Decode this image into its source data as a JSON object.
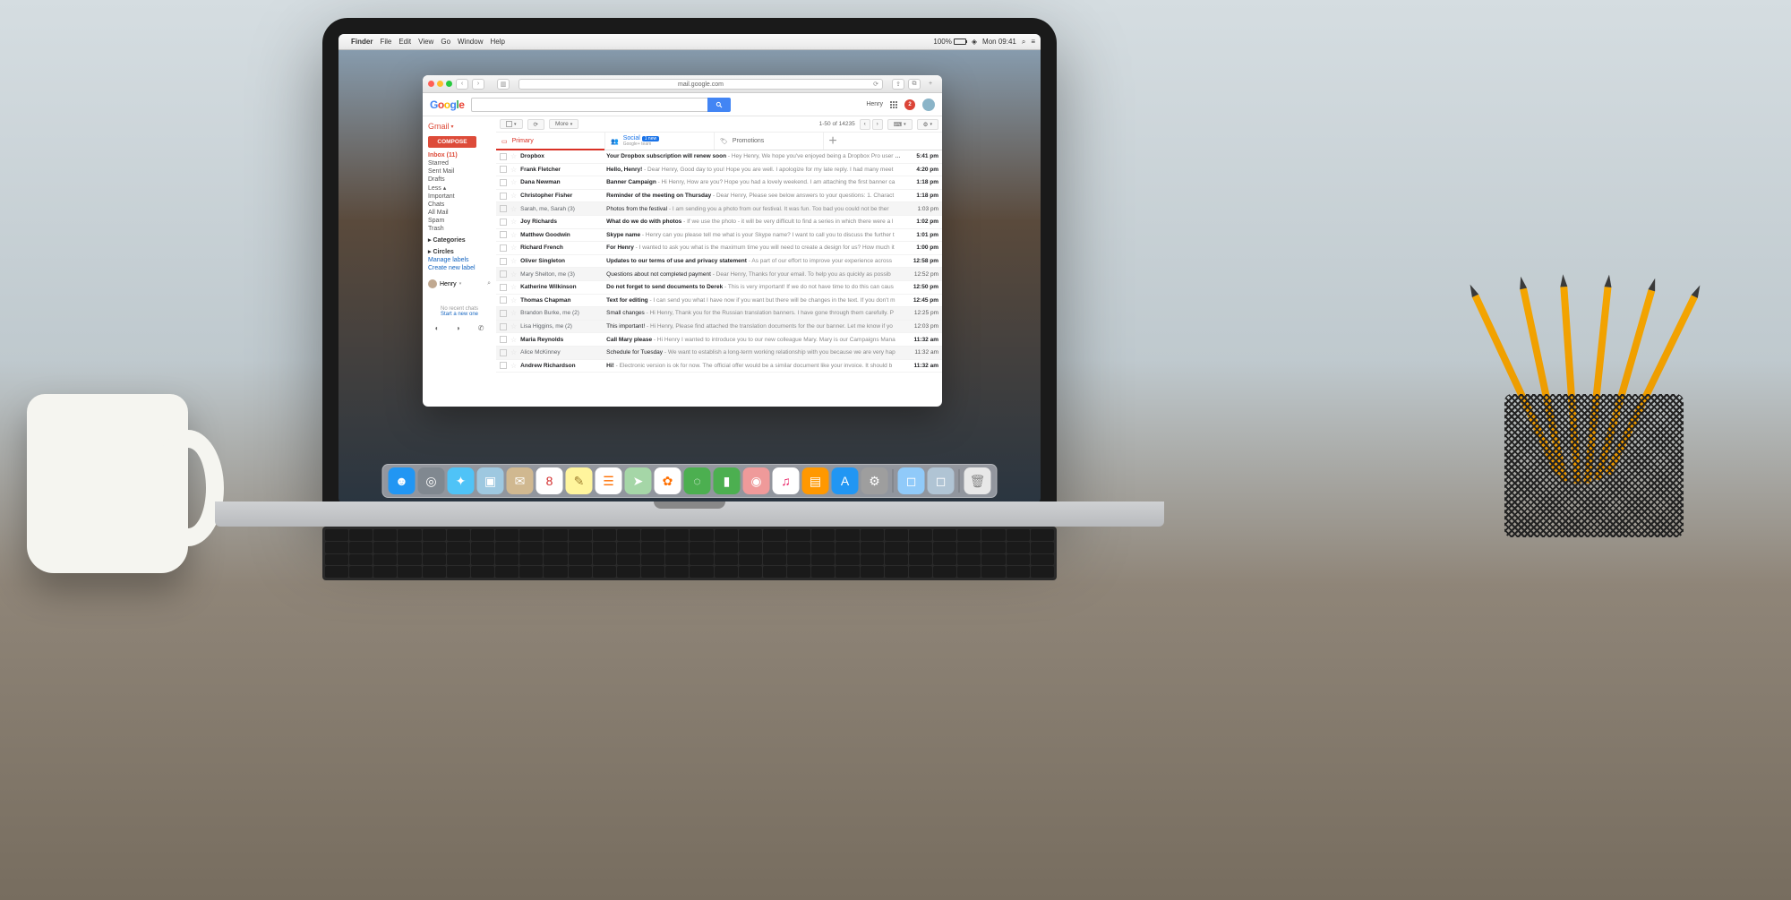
{
  "menubar": {
    "app": "Finder",
    "items": [
      "File",
      "Edit",
      "View",
      "Go",
      "Window",
      "Help"
    ],
    "battery": "100%",
    "clock": "Mon 09:41"
  },
  "browser": {
    "url": "mail.google.com"
  },
  "gmail": {
    "brand": "Gmail",
    "user": "Henry",
    "notif_count": "2",
    "compose": "COMPOSE",
    "pager": "1-50 of 14235",
    "more": "More",
    "sidebar_bottom": {
      "msg": "No recent chats",
      "link": "Start a new one"
    },
    "sidebar": [
      {
        "label": "Inbox (11)",
        "active": true
      },
      {
        "label": "Starred"
      },
      {
        "label": "Sent Mail"
      },
      {
        "label": "Drafts"
      },
      {
        "label": "Less",
        "arrow": true
      },
      {
        "label": "Important"
      },
      {
        "label": "Chats"
      },
      {
        "label": "All Mail"
      },
      {
        "label": "Spam"
      },
      {
        "label": "Trash"
      },
      {
        "label": "Categories",
        "heading": true
      },
      {
        "label": "Circles",
        "heading": true
      },
      {
        "label": "Manage labels",
        "link": true
      },
      {
        "label": "Create new label",
        "link": true
      }
    ],
    "tabs": {
      "primary": "Primary",
      "social": "Social",
      "social_badge": "1 new",
      "social_sub": "Google+ team",
      "promotions": "Promotions"
    },
    "emails": [
      {
        "sender": "Dropbox",
        "subject": "Your Dropbox subscription will renew soon",
        "snippet": " - Hey Henry, We hope you've enjoyed being a Dropbox Pro user for t",
        "time": "5:41 pm",
        "unread": true
      },
      {
        "sender": "Frank Fletcher",
        "subject": "Hello, Henry!",
        "snippet": " - Dear Henry, Good day to you! Hope you are well. I apologize for my late reply. I had many meet",
        "time": "4:20 pm",
        "unread": true
      },
      {
        "sender": "Dana Newman",
        "subject": "Banner Campaign",
        "snippet": " - Hi Henry, How are you? Hope you had a lovely weekend. I am attaching the first banner ca",
        "time": "1:18 pm",
        "unread": true
      },
      {
        "sender": "Christopher Fisher",
        "subject": "Reminder of the meeting on Thursday",
        "snippet": " - Dear Henry, Please see below answers to your questions: 1. Charact",
        "time": "1:18 pm",
        "unread": true
      },
      {
        "sender": "Sarah, me, Sarah (3)",
        "subject": "Photos from the festival",
        "snippet": " - I am sending you a photo from our festival. It was fun. Too bad you could not be ther",
        "time": "1:03 pm",
        "unread": false
      },
      {
        "sender": "Joy Richards",
        "subject": "What do we do with photos",
        "snippet": " - If we use the photo - it will be very difficult to find a series in which there were a l",
        "time": "1:02 pm",
        "unread": true
      },
      {
        "sender": "Matthew Goodwin",
        "subject": "Skype name",
        "snippet": " - Henry can you please tell me what is your Skype name? I want to call you to discuss the further t",
        "time": "1:01 pm",
        "unread": true
      },
      {
        "sender": "Richard French",
        "subject": "For Henry",
        "snippet": " - I wanted to ask you what is the maximum time you will need to create a design for us? How much it",
        "time": "1:00 pm",
        "unread": true
      },
      {
        "sender": "Oliver Singleton",
        "subject": "Updates to our terms of use and privacy statement",
        "snippet": " - As part of our effort to improve your experience across",
        "time": "12:58 pm",
        "unread": true
      },
      {
        "sender": "Mary Shelton, me (3)",
        "subject": "Questions about not completed payment",
        "snippet": " - Dear Henry, Thanks for your email. To help you as quickly as possib",
        "time": "12:52 pm",
        "unread": false
      },
      {
        "sender": "Katherine Wilkinson",
        "subject": "Do not forget to send documents to Derek",
        "snippet": " - This is very important! If we do not have time to do this can caus",
        "time": "12:50 pm",
        "unread": true
      },
      {
        "sender": "Thomas Chapman",
        "subject": "Text for editing",
        "snippet": " - I can send you what I have now if you want but there will be changes in the text. If you don't m",
        "time": "12:45 pm",
        "unread": true
      },
      {
        "sender": "Brandon Burke, me (2)",
        "subject": "Small changes",
        "snippet": " - Hi Henry, Thank you for the Russian translation banners. I have gone through them carefully. P",
        "time": "12:25 pm",
        "unread": false
      },
      {
        "sender": "Lisa Higgins, me (2)",
        "subject": "This important!",
        "snippet": " - Hi Henry, Please find attached the translation documents for the our banner. Let me know if yo",
        "time": "12:03 pm",
        "unread": false
      },
      {
        "sender": "Maria Reynolds",
        "subject": "Call Mary please",
        "snippet": " - Hi Henry I wanted to introduce you to our new colleague Mary. Mary is our Campaigns Mana",
        "time": "11:32 am",
        "unread": true
      },
      {
        "sender": "Alice McKinney",
        "subject": "Schedule for Tuesday",
        "snippet": " - We want to establish a long-term working relationship with you because we are very hap",
        "time": "11:32 am",
        "unread": false
      },
      {
        "sender": "Andrew Richardson",
        "subject": "Hi!",
        "snippet": " - Electronic version is ok for now. The official offer would be a similar document like your invoice. It should b",
        "time": "11:32 am",
        "unread": true
      }
    ]
  },
  "dock": [
    {
      "name": "finder",
      "bg": "#2196f3",
      "glyph": "☻"
    },
    {
      "name": "launchpad",
      "bg": "#808890",
      "glyph": "◎"
    },
    {
      "name": "safari",
      "bg": "#4fc3f7",
      "glyph": "✦"
    },
    {
      "name": "preview",
      "bg": "#9ec8e0",
      "glyph": "▣"
    },
    {
      "name": "mail",
      "bg": "#d0b890",
      "glyph": "✉"
    },
    {
      "name": "calendar",
      "bg": "#ffffff",
      "glyph": "8",
      "fg": "#d32f2f"
    },
    {
      "name": "notes",
      "bg": "#fff59d",
      "glyph": "✎",
      "fg": "#a08030"
    },
    {
      "name": "reminders",
      "bg": "#ffffff",
      "glyph": "☰",
      "fg": "#ff6f00"
    },
    {
      "name": "maps",
      "bg": "#a5d6a7",
      "glyph": "➤"
    },
    {
      "name": "photos",
      "bg": "#ffffff",
      "glyph": "✿",
      "fg": "#ff6f00"
    },
    {
      "name": "messages",
      "bg": "#4caf50",
      "glyph": "◌"
    },
    {
      "name": "facetime",
      "bg": "#4caf50",
      "glyph": "▮"
    },
    {
      "name": "photobooth",
      "bg": "#ef9a9a",
      "glyph": "◉"
    },
    {
      "name": "itunes",
      "bg": "#ffffff",
      "glyph": "♫",
      "fg": "#e91e63"
    },
    {
      "name": "ibooks",
      "bg": "#ff9800",
      "glyph": "▤"
    },
    {
      "name": "appstore",
      "bg": "#2196f3",
      "glyph": "A"
    },
    {
      "name": "settings",
      "bg": "#9e9e9e",
      "glyph": "⚙"
    },
    {
      "name": "app1",
      "bg": "#90caf9",
      "glyph": "◻"
    },
    {
      "name": "app2",
      "bg": "#b0c4d4",
      "glyph": "◻"
    }
  ]
}
